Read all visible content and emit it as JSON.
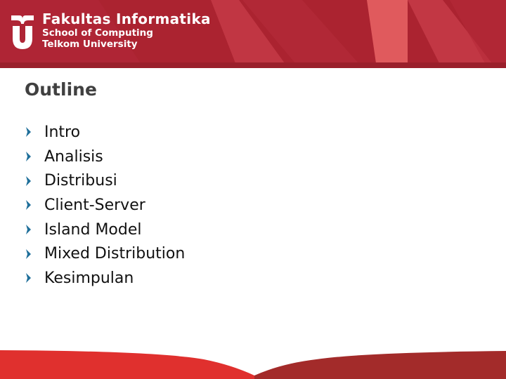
{
  "header": {
    "title": "Fakultas Informatika",
    "subtitle_1": "School of Computing",
    "subtitle_2": "Telkom University",
    "logo_icon": "telkom-university-logo",
    "colors": {
      "primary": "#a8212f",
      "light": "#e05a5d",
      "strip": "#9a1f2b"
    }
  },
  "slide": {
    "title": "Outline",
    "bullet_icon": "chevron-right-icon",
    "bullet_color": "#1f6f9a",
    "items": [
      {
        "label": "Intro"
      },
      {
        "label": "Analisis"
      },
      {
        "label": "Distribusi"
      },
      {
        "label": "Client-Server"
      },
      {
        "label": "Island Model"
      },
      {
        "label": "Mixed Distribution"
      },
      {
        "label": "Kesimpulan"
      }
    ]
  },
  "footer": {
    "colors": {
      "left": "#e0302e",
      "right": "#a32b2a"
    }
  }
}
